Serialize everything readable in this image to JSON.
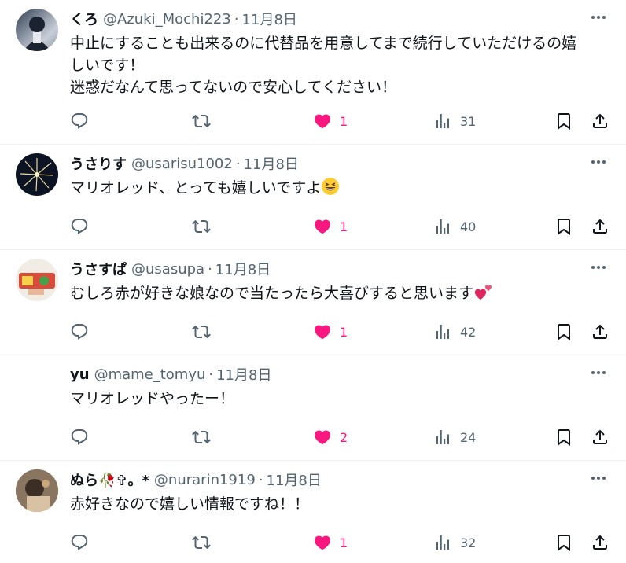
{
  "replies": [
    {
      "name": "くろ",
      "handle": "@Azuki_Mochi223",
      "date": "11月8日",
      "text_lines": [
        "中止にすることも出来るのに代替品を用意してまで続行していただけるの嬉",
        "しいです！",
        "迷惑だなんて思ってないので安心してください！"
      ],
      "likes": "1",
      "views": "31"
    },
    {
      "name": "うさりす",
      "handle": "@usarisu1002",
      "date": "11月8日",
      "text_lines": [
        "マリオレッド、とっても嬉しいですよ"
      ],
      "likes": "1",
      "views": "40"
    },
    {
      "name": "うさすぱ",
      "handle": "@usasupa",
      "date": "11月8日",
      "text_lines": [
        "むしろ赤が好きな娘なので当たったら大喜びすると思います"
      ],
      "likes": "1",
      "views": "42"
    },
    {
      "name": "yu",
      "handle": "@mame_tomyu",
      "date": "11月8日",
      "text_lines": [
        "マリオレッドやったー！"
      ],
      "likes": "2",
      "views": "24"
    },
    {
      "name": "ぬら🥀✞。*",
      "handle": "@nurarin1919",
      "date": "11月8日",
      "text_lines": [
        "赤好きなので嬉しい情報ですね！！"
      ],
      "likes": "1",
      "views": "32"
    }
  ],
  "separator": "·",
  "colors": {
    "like": "#f91880",
    "muted": "#536471",
    "text": "#0f1419"
  },
  "icons": [
    "reply-icon",
    "retweet-icon",
    "heart-icon",
    "views-icon",
    "bookmark-icon",
    "share-icon",
    "more-icon"
  ]
}
